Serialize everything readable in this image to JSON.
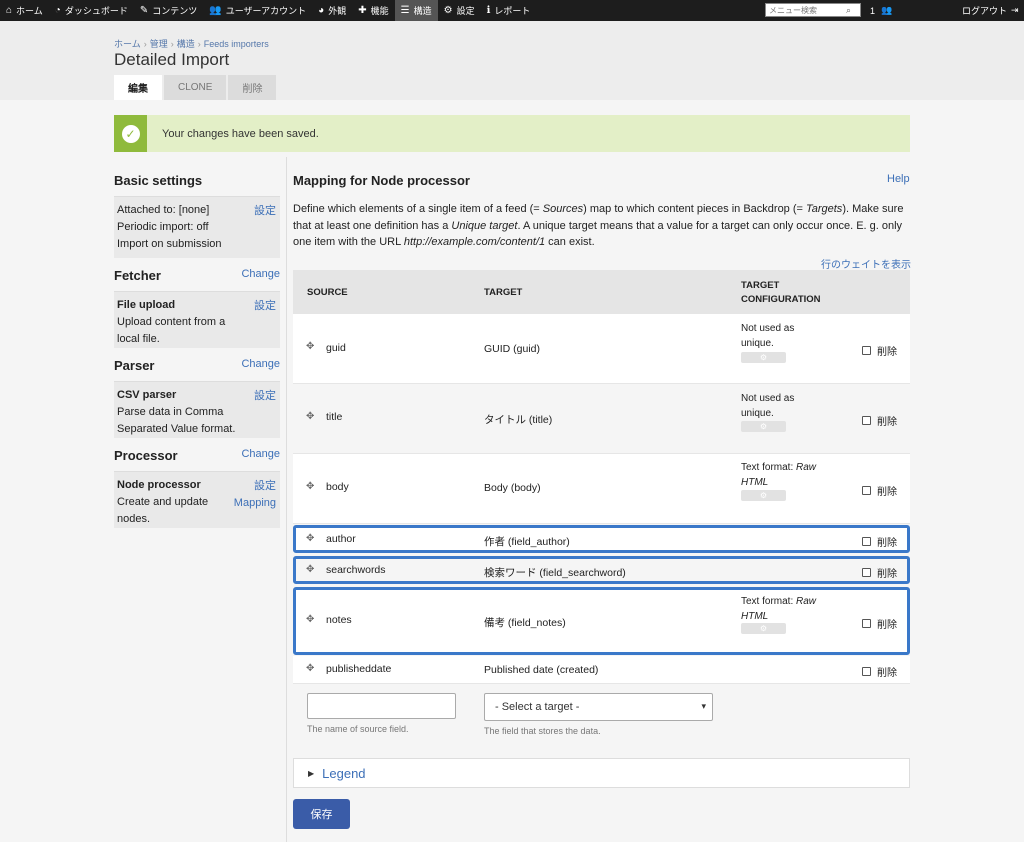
{
  "adminbar": {
    "items": [
      {
        "icon": "home-icon",
        "glyph": "⌂",
        "label": "ホーム"
      },
      {
        "icon": "dashboard-icon",
        "glyph": "◔",
        "label": "ダッシュボード"
      },
      {
        "icon": "pencil-icon",
        "glyph": "✎",
        "label": "コンテンツ"
      },
      {
        "icon": "users-icon",
        "glyph": "👥",
        "label": "ユーザーアカウント"
      },
      {
        "icon": "palette-icon",
        "glyph": "◕",
        "label": "外観"
      },
      {
        "icon": "puzzle-icon",
        "glyph": "✚",
        "label": "機能"
      },
      {
        "icon": "structure-icon",
        "glyph": "☰",
        "label": "構造"
      },
      {
        "icon": "gear-icon",
        "glyph": "⚙",
        "label": "設定"
      },
      {
        "icon": "info-icon",
        "glyph": "ℹ",
        "label": "レポート"
      }
    ],
    "search_placeholder": "メニュー検索",
    "user_count": "1",
    "logout": "ログアウト"
  },
  "breadcrumb": [
    "ホーム",
    "管理",
    "構造",
    "Feeds importers"
  ],
  "page_title": "Detailed Import",
  "tabs": [
    "編集",
    "CLONE",
    "削除"
  ],
  "status_message": "Your changes have been saved.",
  "sidebar": {
    "basic": {
      "title": "Basic settings",
      "lines": [
        "Attached to: [none]",
        "Periodic import: off",
        "Import on submission"
      ],
      "link": "設定"
    },
    "fetcher": {
      "title": "Fetcher",
      "change": "Change",
      "name": "File upload",
      "desc": "Upload content from a local file.",
      "link": "設定"
    },
    "parser": {
      "title": "Parser",
      "change": "Change",
      "name": "CSV parser",
      "desc": "Parse data in Comma Separated Value format.",
      "link": "設定"
    },
    "processor": {
      "title": "Processor",
      "change": "Change",
      "name": "Node processor",
      "desc": "Create and update nodes.",
      "link": "設定",
      "link2": "Mapping"
    }
  },
  "main": {
    "title": "Mapping for Node processor",
    "help": "Help",
    "desc_parts": [
      "Define which elements of a single item of a feed (= ",
      "Sources",
      ") map to which content pieces in Backdrop (= ",
      "Targets",
      "). Make sure that at least one definition has a ",
      "Unique target",
      ". A unique target means that a value for a target can only occur once. E. g. only one item with the URL ",
      "http://example.com/content/1",
      " can exist."
    ],
    "show_weights": "行のウェイトを表示",
    "columns": {
      "source": "SOURCE",
      "target": "TARGET",
      "config_1": "TARGET",
      "config_2": "CONFIGURATION"
    },
    "rows": [
      {
        "source": "guid",
        "target": "GUID (guid)",
        "config_1": "Not used as",
        "config_2": "unique.",
        "delete": "削除"
      },
      {
        "source": "title",
        "target": "タイトル (title)",
        "config_1": "Not used as",
        "config_2": "unique.",
        "delete": "削除"
      },
      {
        "source": "body",
        "target": "Body (body)",
        "config_1": "Text format: ",
        "config_1i": "Raw",
        "config_2i": "HTML",
        "delete": "削除"
      },
      {
        "source": "author",
        "target": "作者 (field_author)",
        "delete": "削除"
      },
      {
        "source": "searchwords",
        "target": "検索ワード (field_searchword)",
        "delete": "削除"
      },
      {
        "source": "notes",
        "target": "備考 (field_notes)",
        "config_1": "Text format: ",
        "config_1i": "Raw",
        "config_2i": "HTML",
        "delete": "削除"
      },
      {
        "source": "publisheddate",
        "target": "Published date (created)",
        "delete": "削除"
      }
    ],
    "new_source_value": "",
    "new_source_hint": "The name of source field.",
    "new_target_select": "- Select a target -",
    "new_target_hint": "The field that stores the data.",
    "legend": "Legend",
    "save": "保存"
  },
  "colors": {
    "accent": "#3a78c9",
    "button": "#3a5ca8",
    "status_bg": "#e3efc7",
    "status_icon": "#8fba3c"
  }
}
